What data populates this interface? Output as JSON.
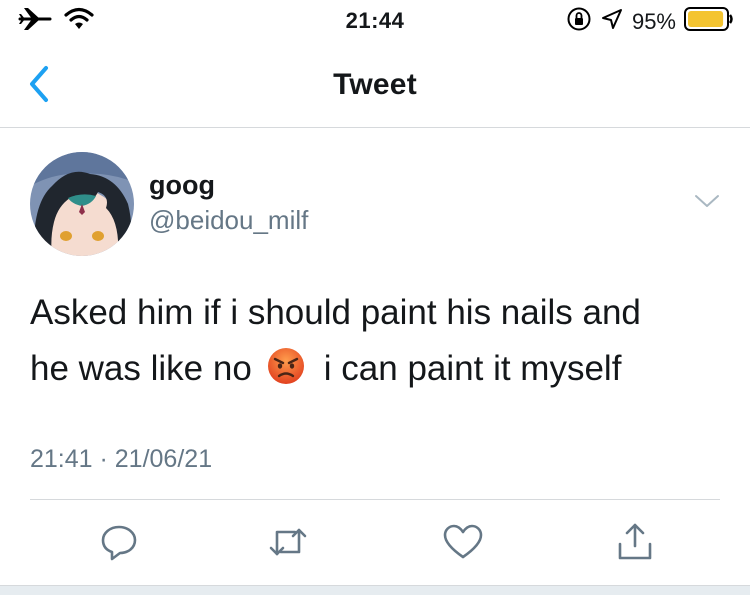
{
  "colors": {
    "accent": "#1da1f2",
    "text": "#14171a",
    "secondary": "#657786",
    "divider": "#d6d9dc",
    "battery": "#f4c430"
  },
  "status_bar": {
    "time": "21:44",
    "battery_percent": "95%",
    "battery_level": 0.95,
    "icons": [
      "airplane-icon",
      "wifi-icon",
      "orientation-lock-icon",
      "location-icon",
      "battery-icon"
    ]
  },
  "nav": {
    "title": "Tweet",
    "back_icon": "chevron-left-icon"
  },
  "tweet": {
    "display_name": "goog",
    "handle": "@beidou_milf",
    "text_line1": "Asked him if i should paint his nails and",
    "text_line2_before": "he was like no",
    "emoji": "angry-face-emoji",
    "text_line2_after": "i can paint it myself",
    "timestamp": "21:41 · 21/06/21"
  },
  "actions": [
    "reply-icon",
    "retweet-icon",
    "like-icon",
    "share-icon"
  ]
}
